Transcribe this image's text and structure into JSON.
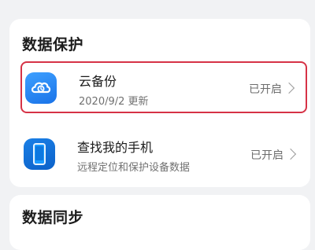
{
  "sections": {
    "data_protection": {
      "title": "数据保护",
      "items": [
        {
          "title": "云备份",
          "subtitle": "2020/9/2 更新",
          "status": "已开启",
          "icon": "cloud-backup-icon"
        },
        {
          "title": "查找我的手机",
          "subtitle": "远程定位和保护设备数据",
          "status": "已开启",
          "icon": "phone-icon"
        }
      ]
    },
    "data_sync": {
      "title": "数据同步"
    }
  },
  "colors": {
    "highlight": "#d63246",
    "icon_blue": "#1a73e8",
    "background": "#f1f2f4"
  }
}
